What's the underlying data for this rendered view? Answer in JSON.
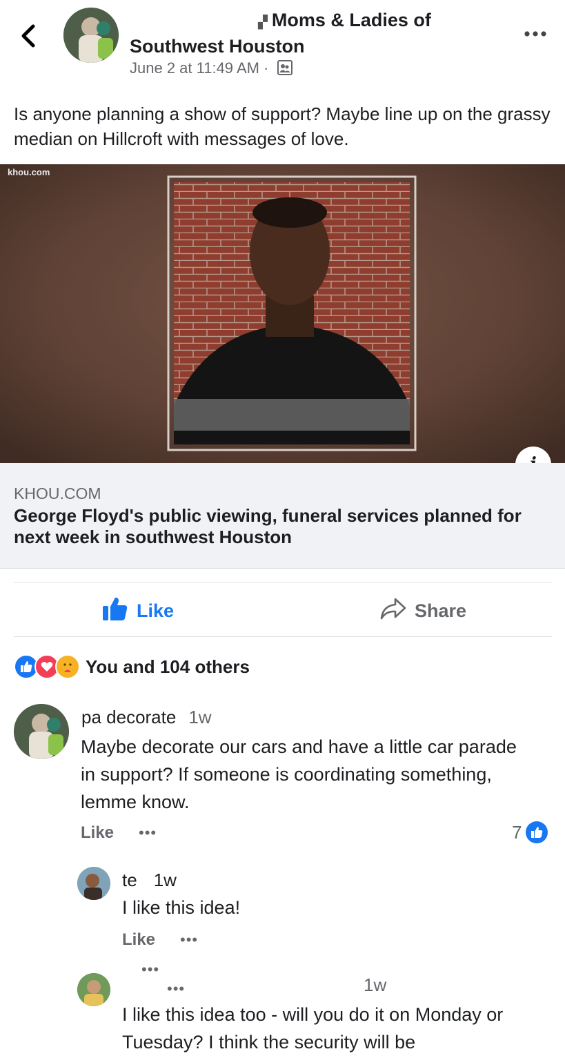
{
  "header": {
    "group_name_line1": "Moms & Ladies of",
    "group_name_line2": "Southwest Houston",
    "timestamp": "June 2 at 11:49 AM ·"
  },
  "post": {
    "text": "Is anyone planning a show of support? Maybe line up on the grassy median on Hillcroft with messages of love."
  },
  "link": {
    "image_source": "khou.com",
    "domain": "KHOU.COM",
    "title": "George Floyd's public viewing, funeral services planned for next week in southwest Houston"
  },
  "actions": {
    "like_label": "Like",
    "share_label": "Share"
  },
  "reactions": {
    "summary": "You and 104 others",
    "icons": [
      "like-icon",
      "love-icon",
      "care-icon"
    ]
  },
  "comments": [
    {
      "author": "pa decorate",
      "time": "1w",
      "text": "Maybe decorate our cars and have a little car parade in support?  If someone is coordinating something, lemme know.",
      "like_label": "Like",
      "reaction_count": "7"
    },
    {
      "author": "te",
      "time": "1w",
      "text": "I like this idea!",
      "like_label": "Like"
    },
    {
      "author": "",
      "time": "1w",
      "text": "I like this idea too - will you do it on Monday or Tuesday? I think the security will be"
    }
  ],
  "colors": {
    "accent": "#1877f2",
    "secondary_text": "#65676b",
    "link_footer_bg": "#f0f2f5",
    "love": "#f33e58",
    "care": "#f7b125"
  }
}
